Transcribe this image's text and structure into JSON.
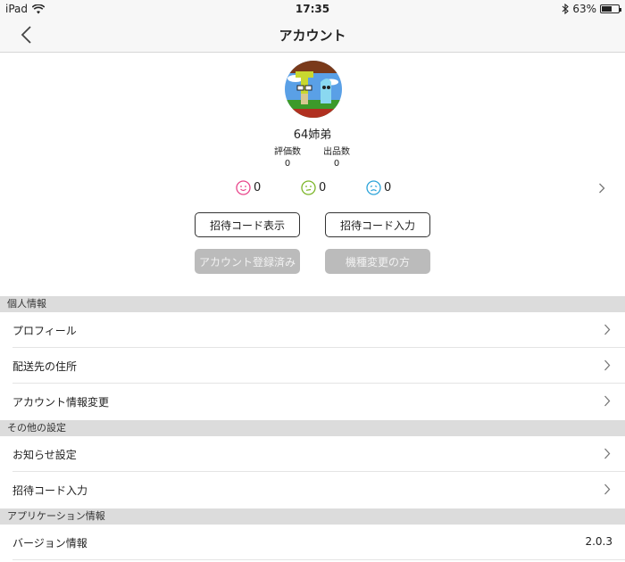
{
  "status_bar": {
    "device": "iPad",
    "time": "17:35",
    "battery": "63%",
    "battery_level": 0.63
  },
  "nav": {
    "title": "アカウント"
  },
  "profile": {
    "username": "64姉弟",
    "stats": [
      {
        "label": "評価数",
        "value": "0"
      },
      {
        "label": "出品数",
        "value": "0"
      }
    ],
    "ratings": [
      {
        "icon": "smile-face-icon",
        "color": "#e8458b",
        "count": "0"
      },
      {
        "icon": "neutral-face-icon",
        "color": "#7bb526",
        "count": "0"
      },
      {
        "icon": "sad-face-icon",
        "color": "#2aa3d9",
        "count": "0"
      }
    ],
    "buttons": {
      "show_invite": "招待コード表示",
      "enter_invite": "招待コード入力",
      "registered": "アカウント登録済み",
      "device_change": "機種変更の方"
    }
  },
  "sections": [
    {
      "title": "個人情報",
      "items": [
        "プロフィール",
        "配送先の住所",
        "アカウント情報変更"
      ]
    },
    {
      "title": "その他の設定",
      "items": [
        "お知らせ設定",
        "招待コード入力"
      ]
    },
    {
      "title": "アプリケーション情報",
      "items": [
        {
          "label": "バージョン情報",
          "value": "2.0.3"
        }
      ]
    }
  ]
}
